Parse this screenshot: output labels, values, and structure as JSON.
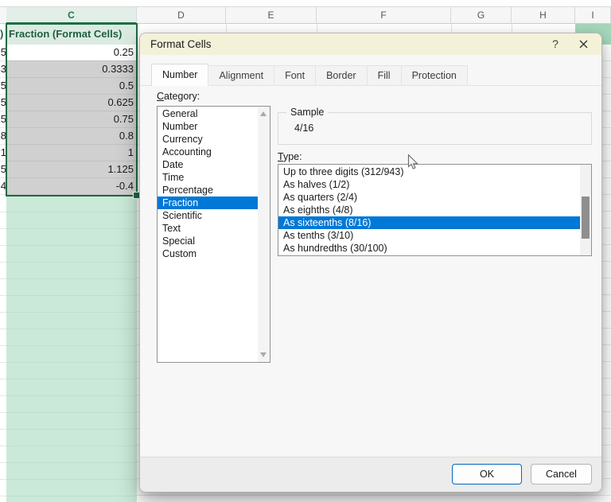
{
  "sheet": {
    "columns": [
      "C",
      "D",
      "E",
      "F",
      "G",
      "H",
      "I"
    ],
    "selected_column": "C",
    "left_column_partials": {
      "header_fragment": ")",
      "value_fragments": [
        "5",
        "3",
        "5",
        "5",
        "5",
        "8",
        "1",
        "5",
        "4"
      ]
    },
    "fraction_column": {
      "header": "Fraction (Format Cells)",
      "values": [
        "0.25",
        "0.3333",
        "0.5",
        "0.625",
        "0.75",
        "0.8",
        "1",
        "1.125",
        "-0.4"
      ],
      "active_value": "0.25"
    }
  },
  "dialog": {
    "title": "Format Cells",
    "titlebar": {
      "help": "?"
    },
    "tabs": [
      "Number",
      "Alignment",
      "Font",
      "Border",
      "Fill",
      "Protection"
    ],
    "active_tab": "Number",
    "category": {
      "label": "Category:",
      "items": [
        "General",
        "Number",
        "Currency",
        "Accounting",
        "Date",
        "Time",
        "Percentage",
        "Fraction",
        "Scientific",
        "Text",
        "Special",
        "Custom"
      ],
      "selected": "Fraction"
    },
    "sample": {
      "label": "Sample",
      "value": "4/16"
    },
    "type": {
      "label": "Type:",
      "items": [
        "Up to three digits (312/943)",
        "As halves (1/2)",
        "As quarters (2/4)",
        "As eighths (4/8)",
        "As sixteenths (8/16)",
        "As tenths (3/10)",
        "As hundredths (30/100)"
      ],
      "selected": "As sixteenths (8/16)"
    },
    "buttons": {
      "ok": "OK",
      "cancel": "Cancel"
    }
  },
  "colors": {
    "excel_green": "#217346",
    "selection_blue": "#0078d7",
    "titlebar_yellow": "#f3f2d9",
    "column_fill_green": "#cbe9d9",
    "header_cell_green": "#dcebe2",
    "selected_cells_gray": "#d1d0d1",
    "right_table_header_green": "#a6d7ba",
    "ok_button_border": "#0067c0"
  }
}
